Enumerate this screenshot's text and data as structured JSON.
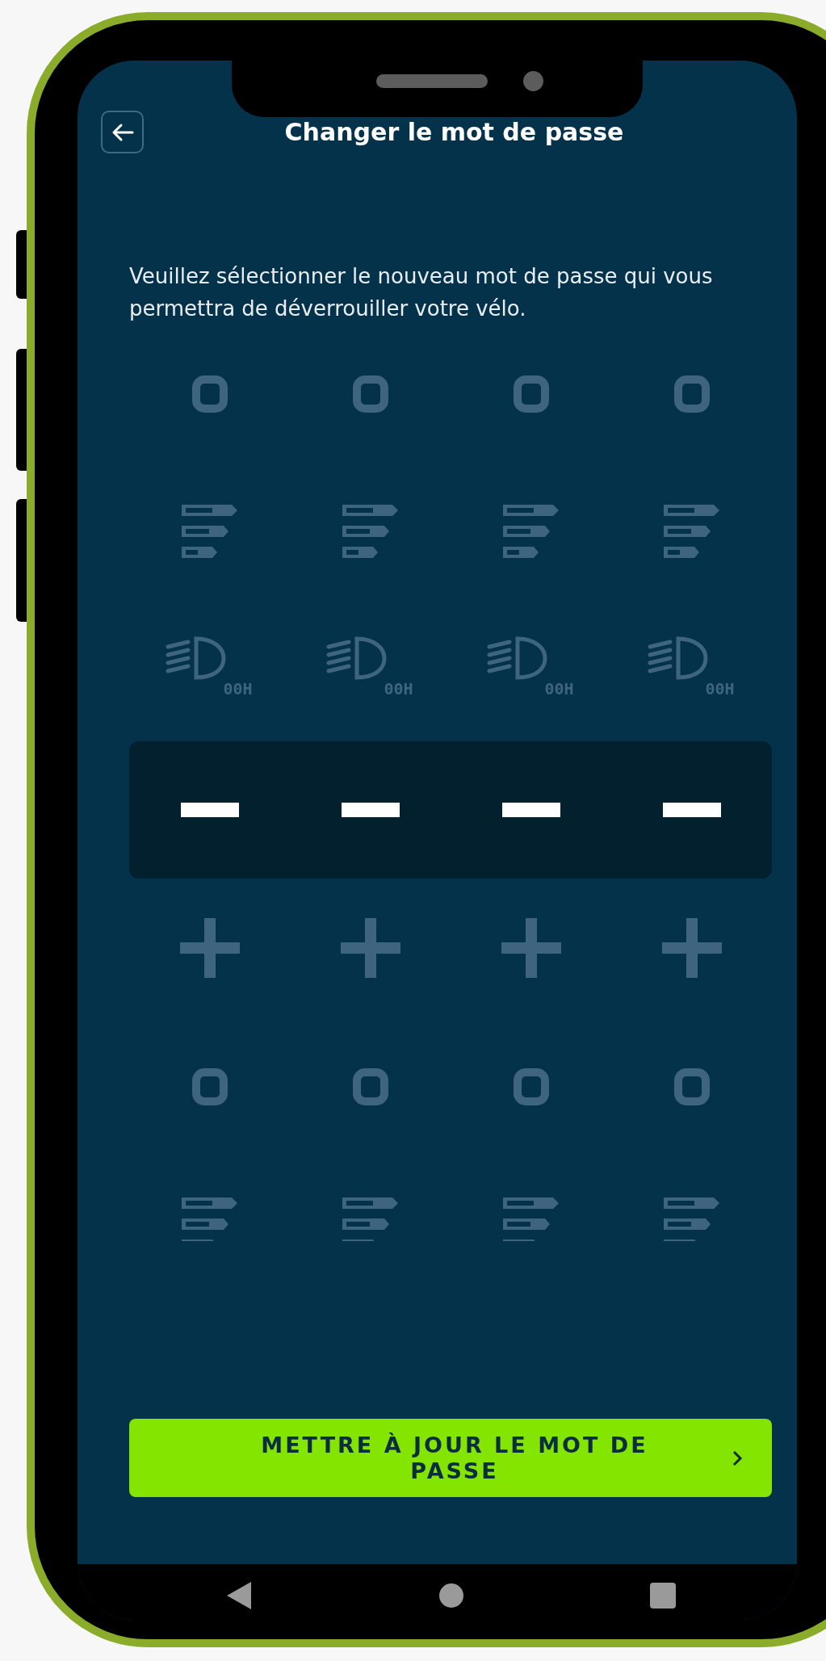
{
  "header": {
    "title": "Changer le mot de passe"
  },
  "instructions": "Veuillez sélectionner le nouveau mot de passe qui vous permettra de déverrouiller votre vélo.",
  "picker": {
    "rows": [
      {
        "selected": false,
        "kind": "ring"
      },
      {
        "selected": false,
        "kind": "bars"
      },
      {
        "selected": false,
        "kind": "headlight",
        "captions": [
          "00H",
          "00H",
          "00H",
          "00H"
        ]
      },
      {
        "selected": true,
        "kind": "dash"
      },
      {
        "selected": false,
        "kind": "plus"
      },
      {
        "selected": false,
        "kind": "ring"
      },
      {
        "selected": false,
        "kind": "bars"
      }
    ]
  },
  "update_button": {
    "label": "METTRE À JOUR LE MOT DE PASSE"
  }
}
